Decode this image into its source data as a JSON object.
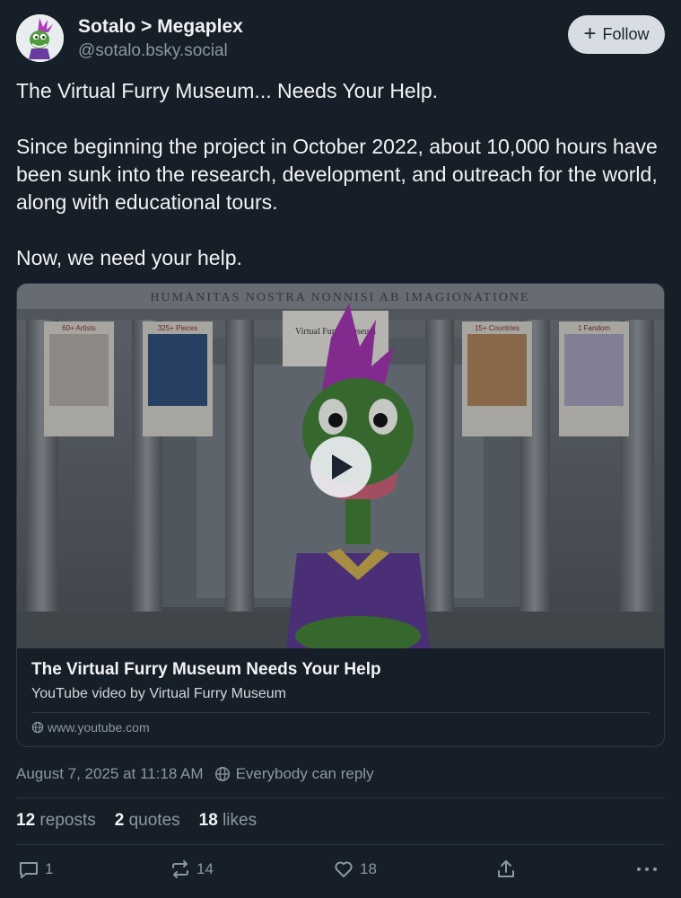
{
  "author": {
    "display_name": "Sotalo > Megaplex",
    "handle": "@sotalo.bsky.social"
  },
  "follow_button": {
    "label": "Follow"
  },
  "post": {
    "paragraphs": [
      "The Virtual Furry Museum... Needs Your Help.",
      "Since beginning the project in October 2022, about 10,000 hours have been sunk into the research, development, and outreach for the world, along with educational tours.",
      "Now, we need your help."
    ]
  },
  "embed": {
    "thumbnail": {
      "inscription": "HUMANITAS NOSTRA NONNISI AB IMAGIONATIONE",
      "banner_labels": [
        "60+ Artists",
        "325+ Pieces",
        "Virtual Furry Museum",
        "15+ Countries",
        "1 Fandom"
      ]
    },
    "title": "The Virtual Furry Museum Needs Your Help",
    "description": "YouTube video by Virtual Furry Museum",
    "domain": "www.youtube.com"
  },
  "meta": {
    "timestamp": "August 7, 2025 at 11:18 AM",
    "reply_setting": "Everybody can reply"
  },
  "stats": {
    "reposts": {
      "count": "12",
      "label": "reposts"
    },
    "quotes": {
      "count": "2",
      "label": "quotes"
    },
    "likes": {
      "count": "18",
      "label": "likes"
    }
  },
  "actions": {
    "reply_count": "1",
    "repost_count": "14",
    "like_count": "18"
  },
  "colors": {
    "background": "#161e27",
    "text_primary": "#f1f3f5",
    "text_secondary": "#8b98a5",
    "follow_button_bg": "#d8dde3",
    "border": "#2e3a47"
  }
}
